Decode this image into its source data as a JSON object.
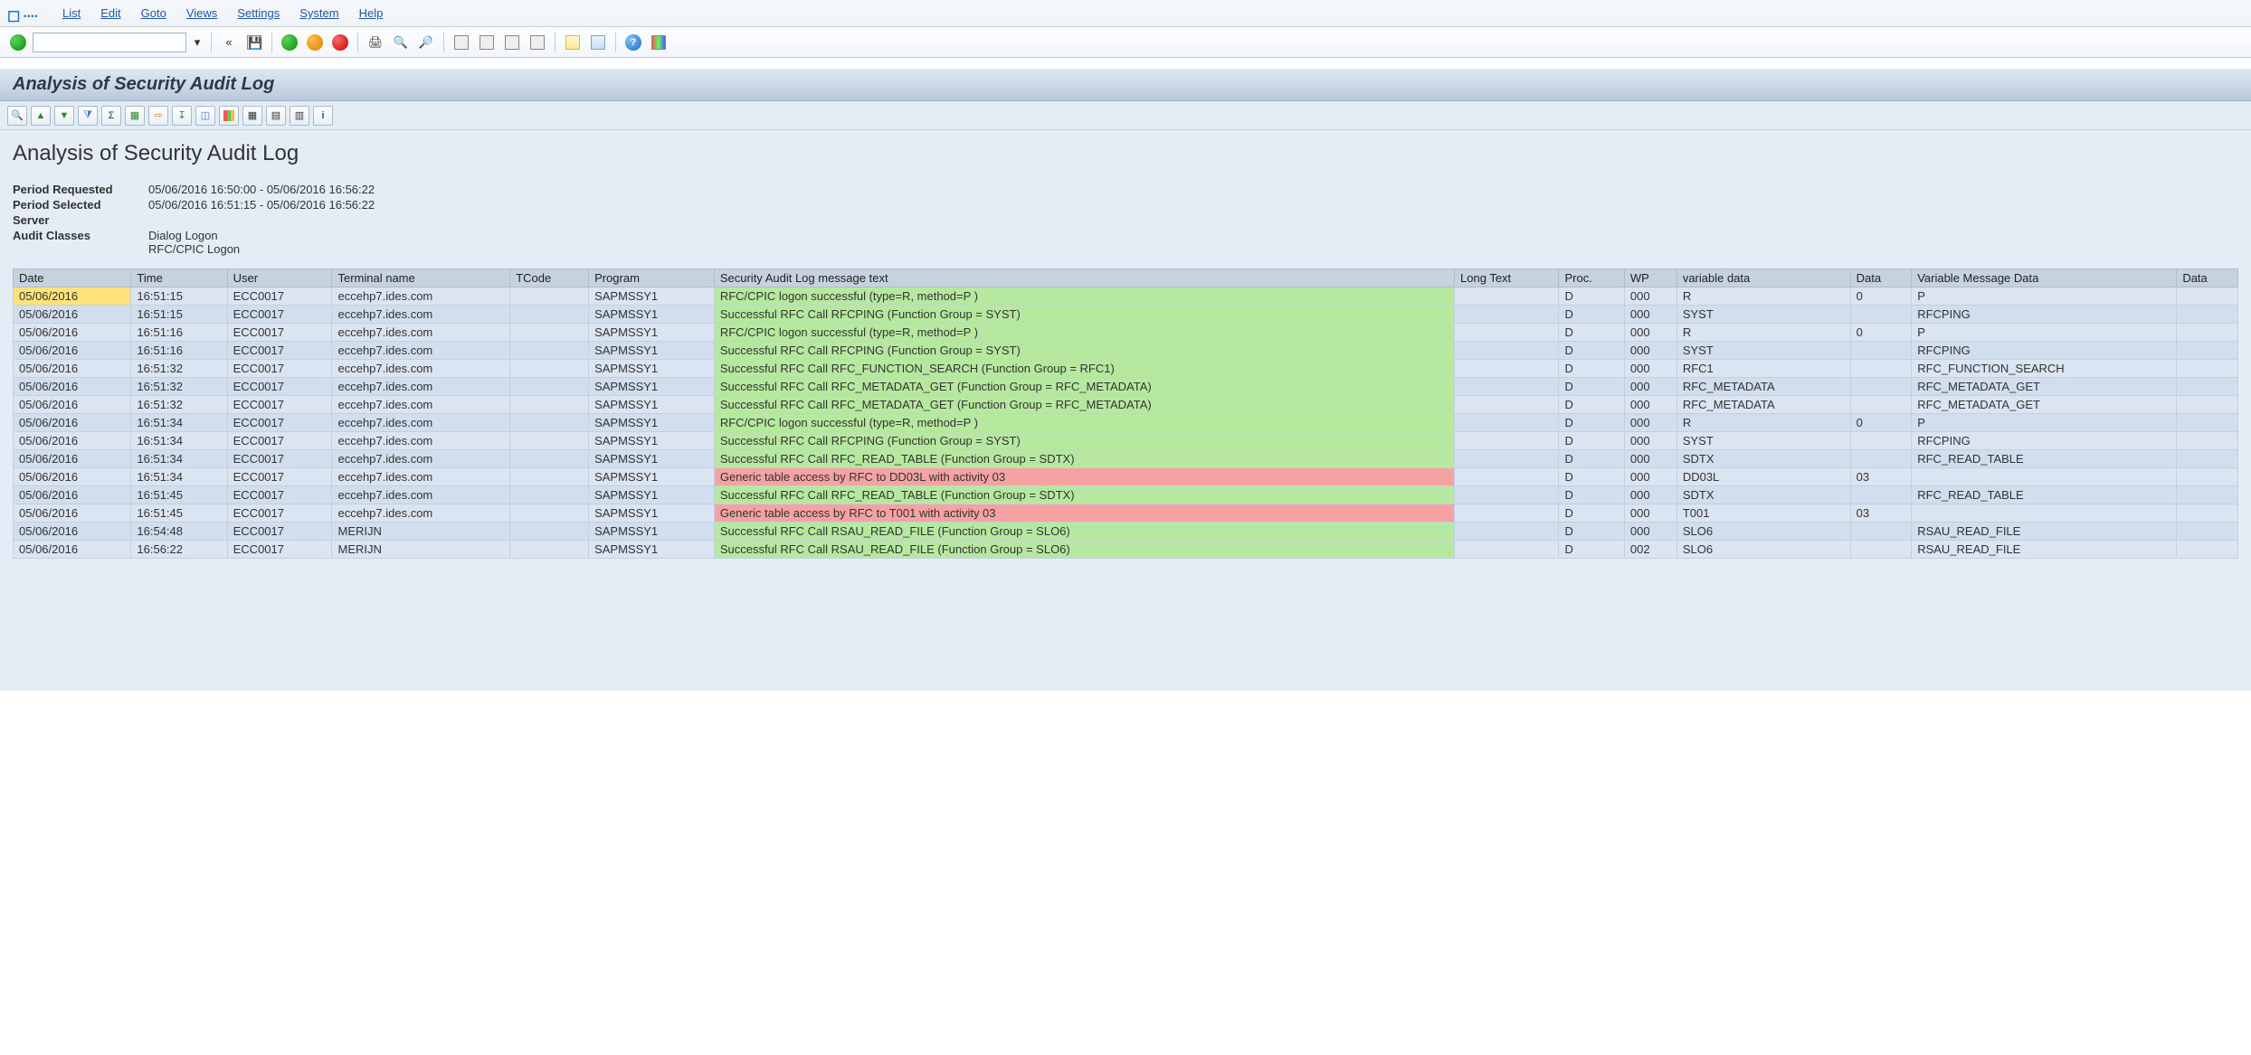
{
  "menu": {
    "items": [
      "List",
      "Edit",
      "Goto",
      "Views",
      "Settings",
      "System",
      "Help"
    ]
  },
  "command_field": {
    "value": "",
    "placeholder": ""
  },
  "titleband": "Analysis of Security Audit Log",
  "page_title": "Analysis of Security Audit Log",
  "meta": {
    "period_requested_label": "Period Requested",
    "period_requested_value": "05/06/2016 16:50:00 - 05/06/2016 16:56:22",
    "period_selected_label": "Period Selected",
    "period_selected_value": "05/06/2016 16:51:15 - 05/06/2016 16:56:22",
    "server_label": "Server",
    "server_value": "",
    "audit_classes_label": "Audit Classes",
    "audit_classes_value1": "Dialog Logon",
    "audit_classes_value2": "RFC/CPIC Logon"
  },
  "columns": [
    "Date",
    "Time",
    "User",
    "Terminal name",
    "TCode",
    "Program",
    "Security Audit Log message text",
    "Long Text",
    "Proc.",
    "WP",
    "variable data",
    "Data",
    "Variable Message Data",
    "Data"
  ],
  "rows": [
    {
      "date": "05/06/2016",
      "time": "16:51:15",
      "user": "ECC0017",
      "term": "eccehp7.ides.com",
      "tcode": "",
      "prog": "SAPMSSY1",
      "msg": "RFC/CPIC logon successful (type=R, method=P )",
      "msgcls": "green",
      "lt": "",
      "proc": "D",
      "wp": "000",
      "var": "R",
      "data1": "0",
      "vmd": "P",
      "data2": "",
      "sel": true
    },
    {
      "date": "05/06/2016",
      "time": "16:51:15",
      "user": "ECC0017",
      "term": "eccehp7.ides.com",
      "tcode": "",
      "prog": "SAPMSSY1",
      "msg": "Successful RFC Call RFCPING (Function Group = SYST)",
      "msgcls": "green",
      "lt": "",
      "proc": "D",
      "wp": "000",
      "var": "SYST",
      "data1": "",
      "vmd": "RFCPING",
      "data2": ""
    },
    {
      "date": "05/06/2016",
      "time": "16:51:16",
      "user": "ECC0017",
      "term": "eccehp7.ides.com",
      "tcode": "",
      "prog": "SAPMSSY1",
      "msg": "RFC/CPIC logon successful (type=R, method=P )",
      "msgcls": "green",
      "lt": "",
      "proc": "D",
      "wp": "000",
      "var": "R",
      "data1": "0",
      "vmd": "P",
      "data2": ""
    },
    {
      "date": "05/06/2016",
      "time": "16:51:16",
      "user": "ECC0017",
      "term": "eccehp7.ides.com",
      "tcode": "",
      "prog": "SAPMSSY1",
      "msg": "Successful RFC Call RFCPING (Function Group = SYST)",
      "msgcls": "green",
      "lt": "",
      "proc": "D",
      "wp": "000",
      "var": "SYST",
      "data1": "",
      "vmd": "RFCPING",
      "data2": ""
    },
    {
      "date": "05/06/2016",
      "time": "16:51:32",
      "user": "ECC0017",
      "term": "eccehp7.ides.com",
      "tcode": "",
      "prog": "SAPMSSY1",
      "msg": "Successful RFC Call RFC_FUNCTION_SEARCH (Function Group = RFC1)",
      "msgcls": "green",
      "lt": "",
      "proc": "D",
      "wp": "000",
      "var": "RFC1",
      "data1": "",
      "vmd": "RFC_FUNCTION_SEARCH",
      "data2": ""
    },
    {
      "date": "05/06/2016",
      "time": "16:51:32",
      "user": "ECC0017",
      "term": "eccehp7.ides.com",
      "tcode": "",
      "prog": "SAPMSSY1",
      "msg": "Successful RFC Call RFC_METADATA_GET (Function Group = RFC_METADATA)",
      "msgcls": "green",
      "lt": "",
      "proc": "D",
      "wp": "000",
      "var": "RFC_METADATA",
      "data1": "",
      "vmd": "RFC_METADATA_GET",
      "data2": ""
    },
    {
      "date": "05/06/2016",
      "time": "16:51:32",
      "user": "ECC0017",
      "term": "eccehp7.ides.com",
      "tcode": "",
      "prog": "SAPMSSY1",
      "msg": "Successful RFC Call RFC_METADATA_GET (Function Group = RFC_METADATA)",
      "msgcls": "green",
      "lt": "",
      "proc": "D",
      "wp": "000",
      "var": "RFC_METADATA",
      "data1": "",
      "vmd": "RFC_METADATA_GET",
      "data2": ""
    },
    {
      "date": "05/06/2016",
      "time": "16:51:34",
      "user": "ECC0017",
      "term": "eccehp7.ides.com",
      "tcode": "",
      "prog": "SAPMSSY1",
      "msg": "RFC/CPIC logon successful (type=R, method=P )",
      "msgcls": "green",
      "lt": "",
      "proc": "D",
      "wp": "000",
      "var": "R",
      "data1": "0",
      "vmd": "P",
      "data2": ""
    },
    {
      "date": "05/06/2016",
      "time": "16:51:34",
      "user": "ECC0017",
      "term": "eccehp7.ides.com",
      "tcode": "",
      "prog": "SAPMSSY1",
      "msg": "Successful RFC Call RFCPING (Function Group = SYST)",
      "msgcls": "green",
      "lt": "",
      "proc": "D",
      "wp": "000",
      "var": "SYST",
      "data1": "",
      "vmd": "RFCPING",
      "data2": ""
    },
    {
      "date": "05/06/2016",
      "time": "16:51:34",
      "user": "ECC0017",
      "term": "eccehp7.ides.com",
      "tcode": "",
      "prog": "SAPMSSY1",
      "msg": "Successful RFC Call RFC_READ_TABLE (Function Group = SDTX)",
      "msgcls": "green",
      "lt": "",
      "proc": "D",
      "wp": "000",
      "var": "SDTX",
      "data1": "",
      "vmd": "RFC_READ_TABLE",
      "data2": ""
    },
    {
      "date": "05/06/2016",
      "time": "16:51:34",
      "user": "ECC0017",
      "term": "eccehp7.ides.com",
      "tcode": "",
      "prog": "SAPMSSY1",
      "msg": "Generic table access by RFC to DD03L with activity 03",
      "msgcls": "red",
      "lt": "",
      "proc": "D",
      "wp": "000",
      "var": "DD03L",
      "data1": "03",
      "vmd": "",
      "data2": ""
    },
    {
      "date": "05/06/2016",
      "time": "16:51:45",
      "user": "ECC0017",
      "term": "eccehp7.ides.com",
      "tcode": "",
      "prog": "SAPMSSY1",
      "msg": "Successful RFC Call RFC_READ_TABLE (Function Group = SDTX)",
      "msgcls": "green",
      "lt": "",
      "proc": "D",
      "wp": "000",
      "var": "SDTX",
      "data1": "",
      "vmd": "RFC_READ_TABLE",
      "data2": ""
    },
    {
      "date": "05/06/2016",
      "time": "16:51:45",
      "user": "ECC0017",
      "term": "eccehp7.ides.com",
      "tcode": "",
      "prog": "SAPMSSY1",
      "msg": "Generic table access by RFC to T001 with activity 03",
      "msgcls": "red",
      "lt": "",
      "proc": "D",
      "wp": "000",
      "var": "T001",
      "data1": "03",
      "vmd": "",
      "data2": ""
    },
    {
      "date": "05/06/2016",
      "time": "16:54:48",
      "user": "ECC0017",
      "term": "MERIJN",
      "tcode": "",
      "prog": "SAPMSSY1",
      "msg": "Successful RFC Call RSAU_READ_FILE (Function Group = SLO6)",
      "msgcls": "green",
      "lt": "",
      "proc": "D",
      "wp": "000",
      "var": "SLO6",
      "data1": "",
      "vmd": "RSAU_READ_FILE",
      "data2": ""
    },
    {
      "date": "05/06/2016",
      "time": "16:56:22",
      "user": "ECC0017",
      "term": "MERIJN",
      "tcode": "",
      "prog": "SAPMSSY1",
      "msg": "Successful RFC Call RSAU_READ_FILE (Function Group = SLO6)",
      "msgcls": "green",
      "lt": "",
      "proc": "D",
      "wp": "002",
      "var": "SLO6",
      "data1": "",
      "vmd": "RSAU_READ_FILE",
      "data2": ""
    }
  ],
  "icons": {
    "ok": "ok-icon",
    "save": "save-icon",
    "back": "back-icon",
    "exit": "exit-icon",
    "cancel": "cancel-icon",
    "print": "print-icon",
    "find": "find-icon",
    "findnext": "find-next-icon",
    "first": "first-page-icon",
    "prev": "prev-page-icon",
    "next": "next-page-icon",
    "last": "last-page-icon",
    "newwin": "new-session-icon",
    "layout": "layout-icon",
    "help": "help-icon",
    "gui": "gui-options-icon"
  }
}
